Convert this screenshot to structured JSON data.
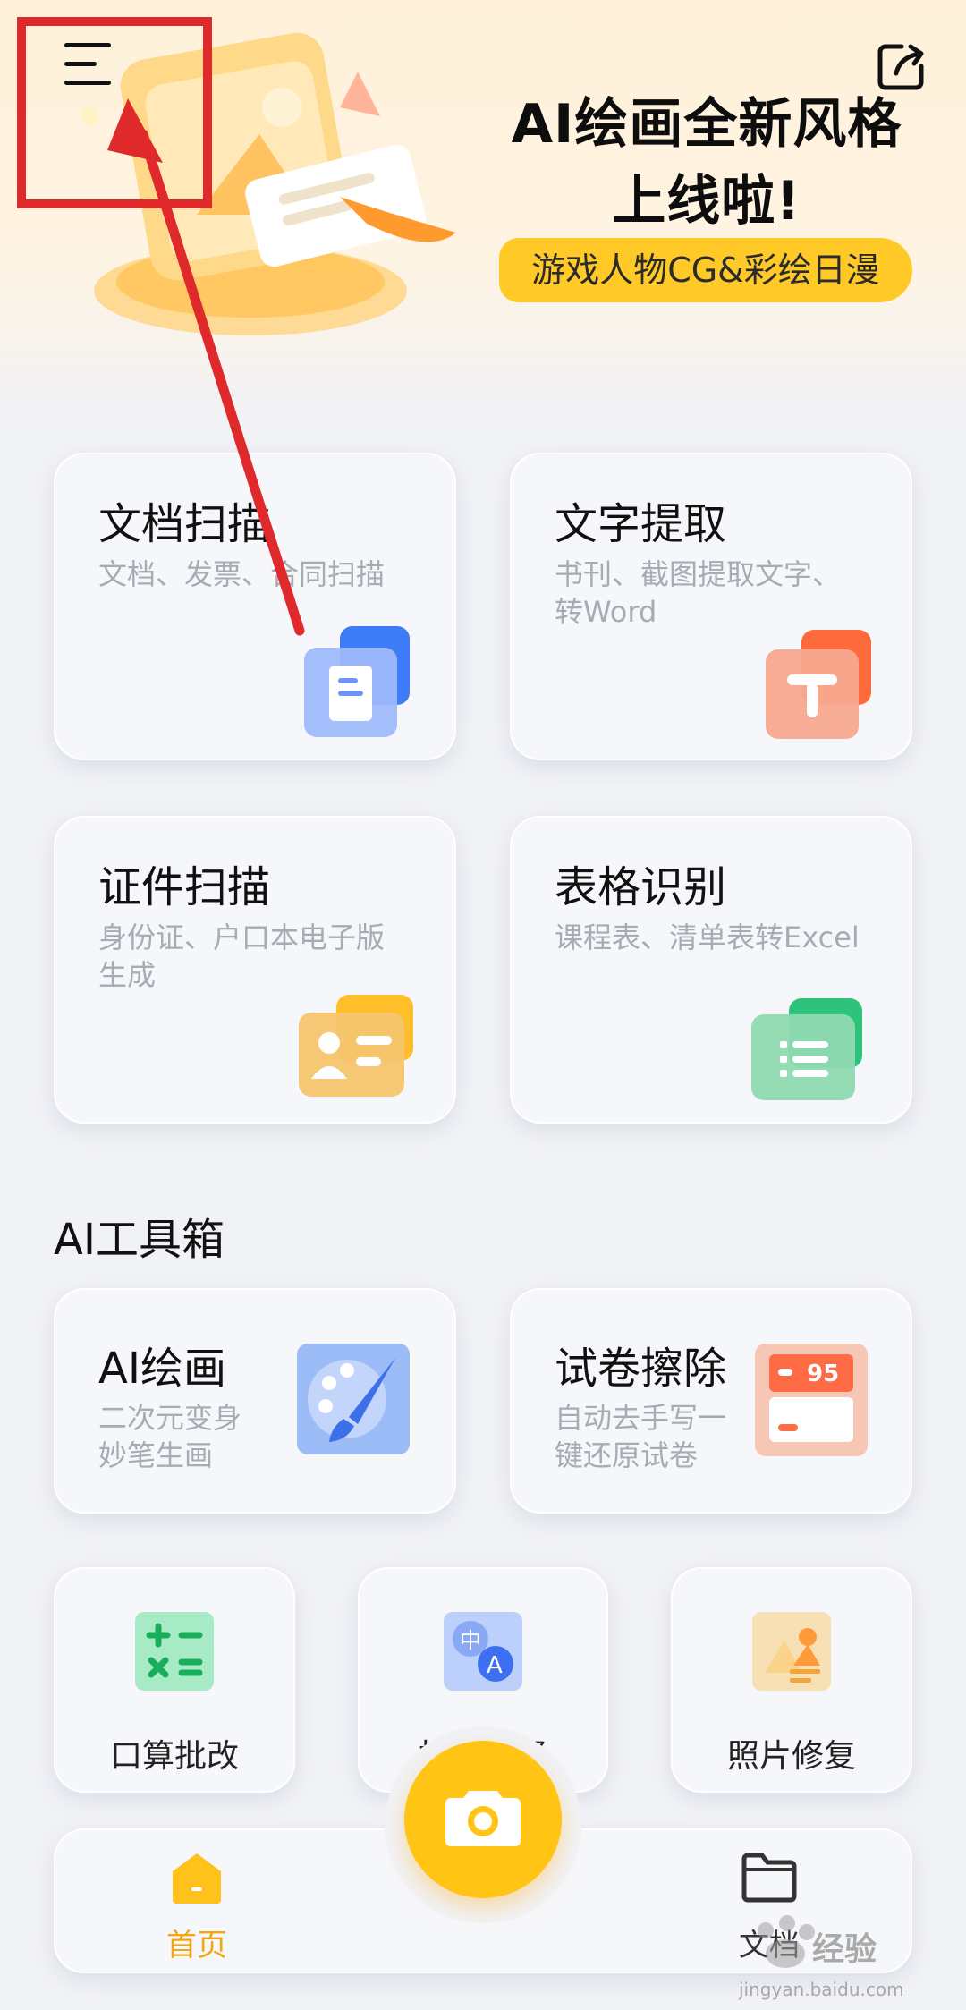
{
  "banner": {
    "title_line1": "AI绘画全新风格",
    "title_line2": "上线啦!",
    "tag": "游戏人物CG&彩绘日漫"
  },
  "main_cards": [
    {
      "title": "文档扫描",
      "subtitle": "文档、发票、合同扫描"
    },
    {
      "title": "文字提取",
      "subtitle": "书刊、截图提取文字、转Word"
    },
    {
      "title": "证件扫描",
      "subtitle": "身份证、户口本电子版生成"
    },
    {
      "title": "表格识别",
      "subtitle": "课程表、清单表转Excel"
    }
  ],
  "toolbox": {
    "title": "AI工具箱",
    "cards": [
      {
        "title": "AI绘画",
        "subtitle": "二次元变身妙笔生画"
      },
      {
        "title": "试卷擦除",
        "subtitle": "自动去手写一键还原试卷",
        "badge": "95"
      }
    ],
    "small_tools": [
      {
        "label": "口算批改"
      },
      {
        "label": "拍照翻译",
        "icon_text_1": "中",
        "icon_text_2": "A"
      },
      {
        "label": "照片修复"
      }
    ]
  },
  "bottom_nav": {
    "home": "首页",
    "docs": "文档"
  },
  "watermark": {
    "brand": "经验",
    "url": "jingyan.baidu.com"
  },
  "colors": {
    "accent_yellow": "#ffc414",
    "nav_active": "#f3a60f",
    "annotation_red": "#e0292b"
  },
  "icons": {
    "menu": "hamburger-menu-icon",
    "share": "share-icon",
    "camera": "camera-icon",
    "home": "home-icon",
    "docs": "folder-icon"
  }
}
